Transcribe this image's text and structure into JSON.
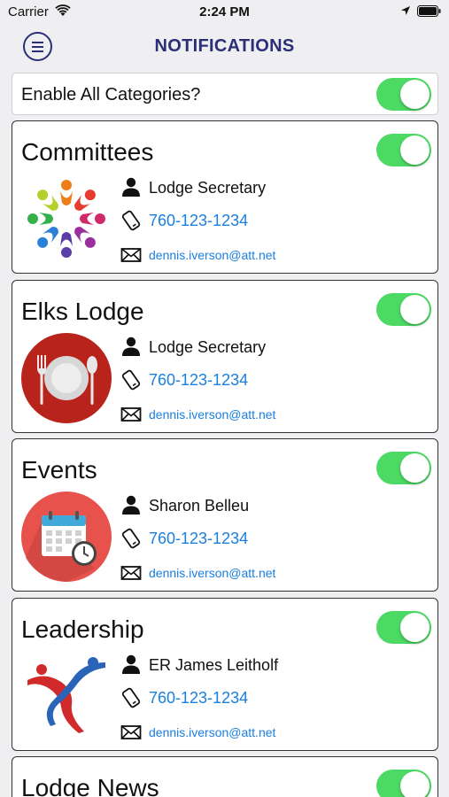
{
  "status_bar": {
    "carrier": "Carrier",
    "time": "2:24 PM"
  },
  "header": {
    "title": "NOTIFICATIONS",
    "menu_icon": "menu-icon"
  },
  "enable_all": {
    "label": "Enable All Categories?",
    "on": true
  },
  "colors": {
    "nav_title": "#2a2f78",
    "link": "#1a7fe0",
    "toggle_on": "#4cd964"
  },
  "categories": [
    {
      "title": "Committees",
      "enabled": true,
      "image": "committees-people-circle",
      "contact": "Lodge Secretary",
      "phone": "760-123-1234",
      "email": "dennis.iverson@att.net"
    },
    {
      "title": "Elks Lodge",
      "enabled": true,
      "image": "plate-fork-spoon",
      "contact": "Lodge Secretary",
      "phone": "760-123-1234",
      "email": "dennis.iverson@att.net"
    },
    {
      "title": "Events",
      "enabled": true,
      "image": "calendar-clock",
      "contact": "Sharon Belleu",
      "phone": "760-123-1234",
      "email": "dennis.iverson@att.net"
    },
    {
      "title": "Leadership",
      "enabled": true,
      "image": "leadership-figures",
      "contact": "ER James Leitholf",
      "phone": "760-123-1234",
      "email": "dennis.iverson@att.net"
    },
    {
      "title": "Lodge News",
      "enabled": true
    }
  ]
}
